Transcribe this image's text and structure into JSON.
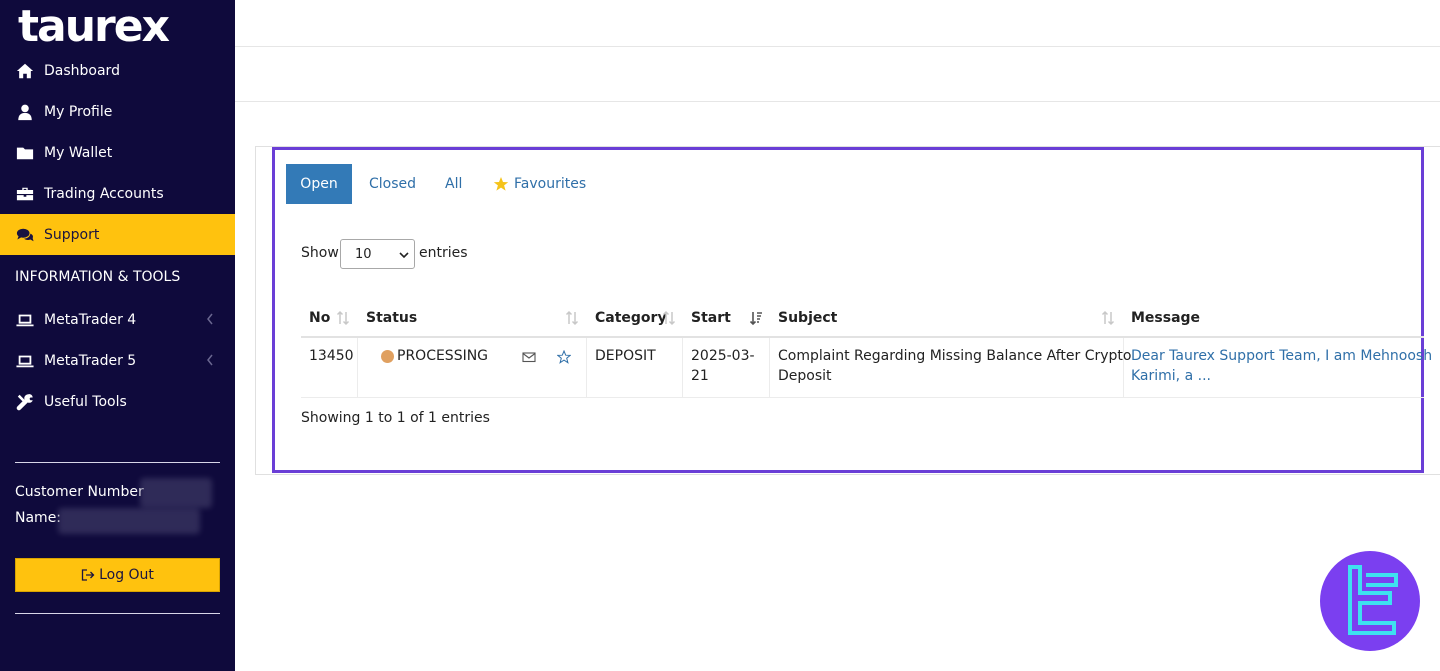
{
  "sidebar": {
    "logo": "taurex",
    "items": [
      {
        "label": "Dashboard",
        "icon": "home-icon"
      },
      {
        "label": "My Profile",
        "icon": "user-icon"
      },
      {
        "label": "My Wallet",
        "icon": "folder-icon"
      },
      {
        "label": "Trading Accounts",
        "icon": "briefcase-icon"
      },
      {
        "label": "Support",
        "icon": "comments-icon",
        "active": true
      }
    ],
    "section_heading": "INFORMATION & TOOLS",
    "tools": [
      {
        "label": "MetaTrader 4",
        "icon": "laptop-icon"
      },
      {
        "label": "MetaTrader 5",
        "icon": "laptop-icon"
      },
      {
        "label": "Useful Tools",
        "icon": "tools-icon"
      }
    ],
    "customer_number_label": "Customer Number",
    "name_label": "Name:",
    "logout_label": "Log Out"
  },
  "tabs": {
    "open": "Open",
    "closed": "Closed",
    "all": "All",
    "favourites": "Favourites"
  },
  "length": {
    "show": "Show",
    "value": "10",
    "entries": "entries"
  },
  "table": {
    "headers": {
      "no": "No",
      "status": "Status",
      "category": "Category",
      "start": "Start",
      "subject": "Subject",
      "message": "Message"
    },
    "rows": [
      {
        "no": "13450",
        "status": "PROCESSING",
        "category": "DEPOSIT",
        "start_line1": "2025-03-",
        "start_line2": "21",
        "subject_line1": "Complaint Regarding Missing Balance After Crypto",
        "subject_line2": "Deposit",
        "message_line1": "Dear Taurex Support Team, I am Mehnoosh",
        "message_line2": "Karimi, a ..."
      }
    ],
    "info": "Showing 1 to 1 of 1 entries"
  },
  "colors": {
    "sidebar_bg": "#0f0a3c",
    "accent": "#ffc20e",
    "tab_active": "#337ab7",
    "highlight": "#6a3ed6",
    "status_processing": "#e0a060"
  }
}
